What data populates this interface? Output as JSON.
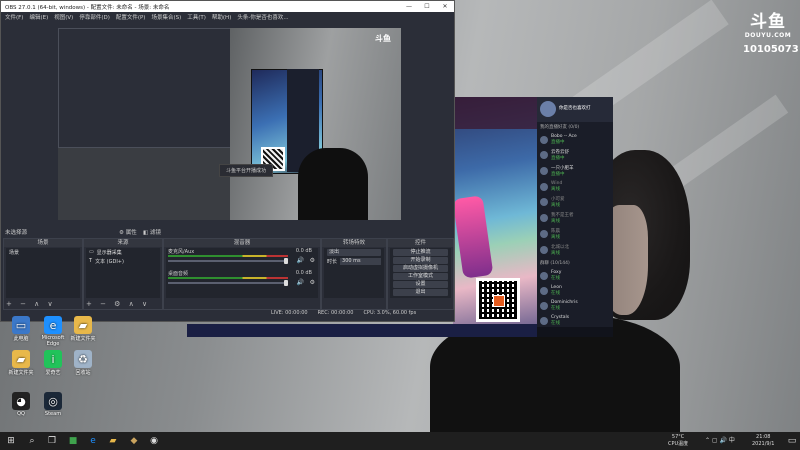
{
  "douyu": {
    "logo": "斗鱼",
    "url": "DOUYU.COM",
    "room_number": "10105073"
  },
  "obs": {
    "title": "OBS 27.0.1 (64-bit, windows) - 配置文件: 未命名 - 场景: 未命名",
    "menu": [
      "文件(F)",
      "编辑(E)",
      "视图(V)",
      "停靠部件(D)",
      "配置文件(P)",
      "场景集合(S)",
      "工具(T)",
      "帮助(H)",
      "头条-你是否也喜欢..."
    ],
    "preview_toast": "斗鱼平台开播成功",
    "preview_logo": "斗鱼",
    "no_source": "未选择源",
    "props_btn": "属性",
    "filters_btn": "滤镜",
    "docks": {
      "scenes": {
        "title": "场景",
        "items": [
          "场景"
        ]
      },
      "sources": {
        "title": "来源",
        "items": [
          "显示器采集",
          "文本 (GDI+)"
        ]
      },
      "mixer": {
        "title": "混音器",
        "channels": [
          {
            "name": "麦克风/Aux",
            "db": "0.0 dB"
          },
          {
            "name": "桌面音频",
            "db": "0.0 dB"
          }
        ]
      },
      "transitions": {
        "title": "转场特效",
        "type": "淡出",
        "duration_label": "时长",
        "duration": "300 ms"
      },
      "controls": {
        "title": "控件",
        "buttons": [
          "停止推流",
          "开始录制",
          "启动虚拟摄像机",
          "工作室模式",
          "设置",
          "退出"
        ]
      }
    },
    "status": {
      "live": "LIVE: 00:00:00",
      "rec": "REC: 00:00:00",
      "cpu": "CPU: 3.0%, 60.00 fps"
    }
  },
  "chat": {
    "room_name": "你是否也喜欢打",
    "section_online": "我的直播好友 (0/0)",
    "friends": [
      {
        "name": "Bobo -- Ace",
        "status": "直播中"
      },
      {
        "name": "云卷云舒",
        "status": "直播中"
      },
      {
        "name": "一只小肥羊",
        "status": "直播中"
      },
      {
        "name": "Wind",
        "status": "离线"
      },
      {
        "name": "小可爱",
        "status": "离线"
      },
      {
        "name": "我不是王者",
        "status": "离线"
      },
      {
        "name": "陈晨",
        "status": "离线"
      },
      {
        "name": "北城以北",
        "status": "离线"
      }
    ],
    "section_group": "群聊 (10/144)",
    "group": [
      {
        "name": "Foxy",
        "status": "在线"
      },
      {
        "name": "Leon",
        "status": "在线"
      },
      {
        "name": "Dominichris",
        "status": "在线"
      },
      {
        "name": "Crystals",
        "status": "在线"
      }
    ]
  },
  "desktop_icons": [
    {
      "label": "此电脑",
      "icon": "computer-icon"
    },
    {
      "label": "Microsoft Edge",
      "icon": "edge-icon"
    },
    {
      "label": "回收站",
      "icon": "recycle-bin-icon"
    },
    {
      "label": "新建文件夹",
      "icon": "folder-icon"
    },
    {
      "label": "QQ",
      "icon": "qq-icon"
    },
    {
      "label": "Steam",
      "icon": "steam-icon"
    },
    {
      "label": "新建文件夹",
      "icon": "folder-icon"
    },
    {
      "label": "爱奇艺",
      "icon": "iqiyi-icon"
    }
  ],
  "taskbar": {
    "weather": "57°C",
    "weather_sub": "CPU温度",
    "time": "21:08",
    "date": "2021/9/1"
  },
  "colors": {
    "douyu_orange": "#ff7a00",
    "taskbar": "#1f1f1f",
    "obs_bg": "#2b2e38"
  }
}
